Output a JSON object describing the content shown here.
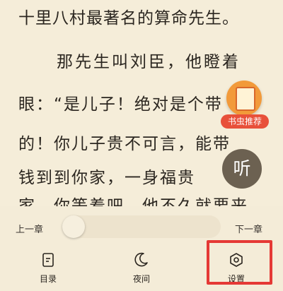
{
  "reader": {
    "lines": [
      "十里八村最著名的算命先生。",
      "那先生叫刘臣，他瞪着",
      "眼：“是儿子！绝对是个带",
      "的！你儿子贵不可言，能带",
      "钱到到你家，一身福贵",
      "家。你等着吧。他不久就要来"
    ]
  },
  "promo": {
    "badge_label": "书虫推荐",
    "icon": "book-icon"
  },
  "listen_button": {
    "label": "听"
  },
  "chapter_nav": {
    "prev_label": "上一章",
    "next_label": "下一章",
    "progress": 0
  },
  "tabs": [
    {
      "label": "目录",
      "icon": "catalog-icon"
    },
    {
      "label": "夜间",
      "icon": "moon-icon"
    },
    {
      "label": "设置",
      "icon": "settings-icon"
    }
  ],
  "colors": {
    "highlight": "#e53935",
    "listen_bg": "#6c6151",
    "badge_bg": "#e8503a"
  }
}
